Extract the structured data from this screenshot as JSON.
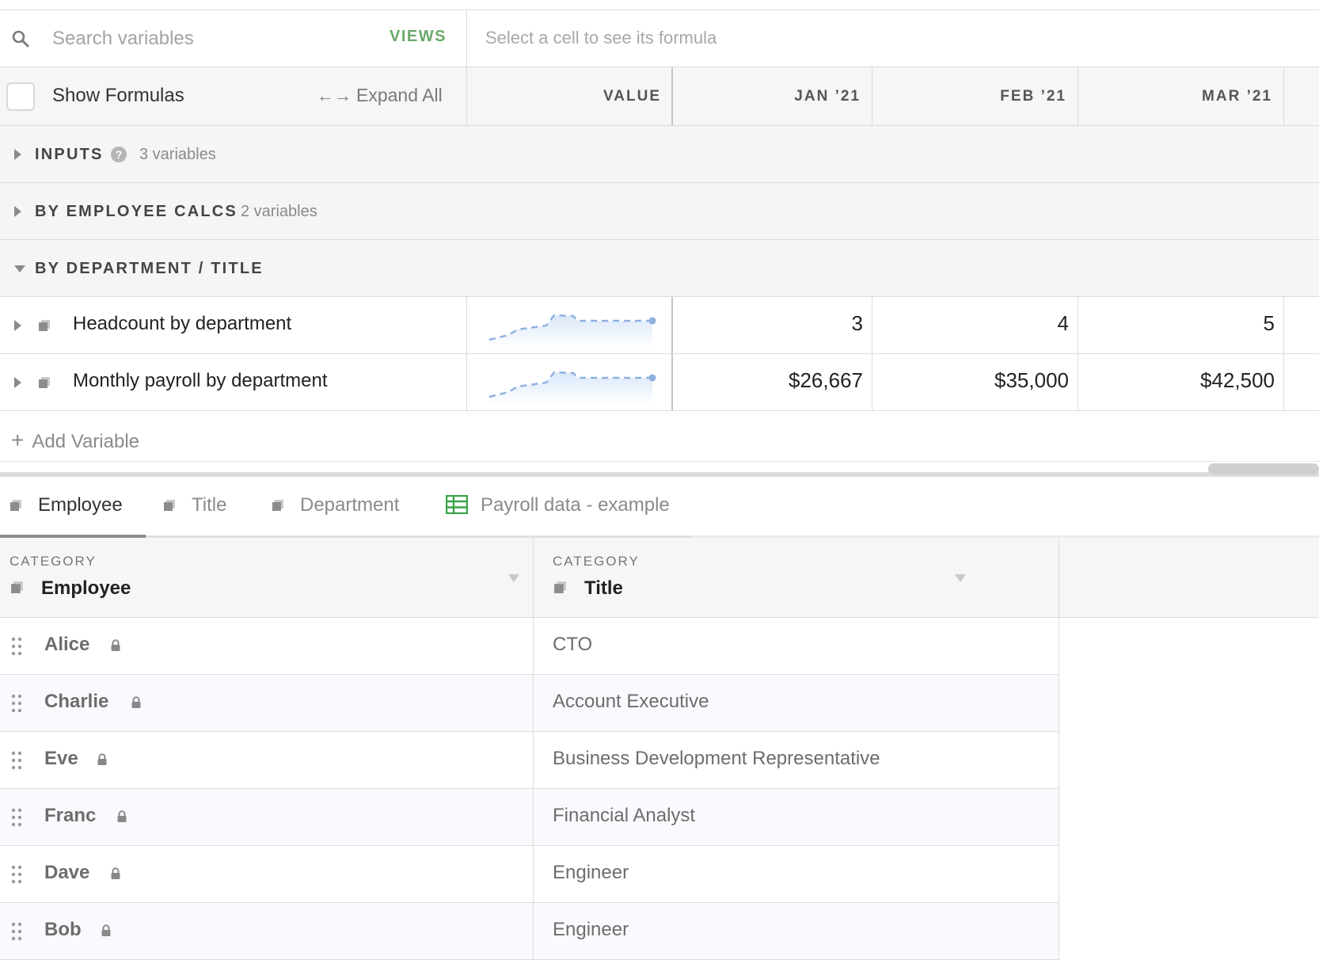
{
  "search": {
    "placeholder": "Search variables",
    "views_label": "VIEWS",
    "formula_hint": "Select a cell to see its formula"
  },
  "toolbar": {
    "show_formulas_label": "Show Formulas",
    "expand_all_arrows": "←→",
    "expand_all_label": "Expand All"
  },
  "columns": {
    "value": "VALUE",
    "months": [
      "JAN ’21",
      "FEB ’21",
      "MAR ’21"
    ]
  },
  "sections": [
    {
      "title": "INPUTS",
      "count": "3 variables",
      "collapsed": true,
      "has_help": true,
      "help_glyph": "?"
    },
    {
      "title": "BY EMPLOYEE CALCS",
      "count": "2 variables",
      "collapsed": true
    },
    {
      "title": "BY DEPARTMENT / TITLE",
      "collapsed": false
    }
  ],
  "variables": [
    {
      "name": "Headcount by department",
      "values": [
        "3",
        "4",
        "5"
      ]
    },
    {
      "name": "Monthly payroll by department",
      "values": [
        "$26,667",
        "$35,000",
        "$42,500"
      ]
    }
  ],
  "add_variable": {
    "plus": "+",
    "label": "Add Variable"
  },
  "tabs": [
    {
      "label": "Employee",
      "icon": "category-icon",
      "active": true
    },
    {
      "label": "Title",
      "icon": "category-icon"
    },
    {
      "label": "Department",
      "icon": "category-icon"
    },
    {
      "label": "Payroll data - example",
      "icon": "spreadsheet-icon"
    }
  ],
  "table": {
    "columns": [
      {
        "sub": "CATEGORY",
        "name": "Employee"
      },
      {
        "sub": "CATEGORY",
        "name": "Title"
      }
    ],
    "rows": [
      {
        "employee": "Alice",
        "title": "CTO"
      },
      {
        "employee": "Charlie",
        "title": "Account Executive"
      },
      {
        "employee": "Eve",
        "title": "Business Development Representative"
      },
      {
        "employee": "Franc",
        "title": "Financial Analyst"
      },
      {
        "employee": "Dave",
        "title": "Engineer"
      },
      {
        "employee": "Bob",
        "title": "Engineer"
      }
    ]
  },
  "colors": {
    "accent_green": "#6aa86a",
    "sparkline_blue": "#8fb0e0",
    "spreadsheet_green": "#3aa44a"
  }
}
